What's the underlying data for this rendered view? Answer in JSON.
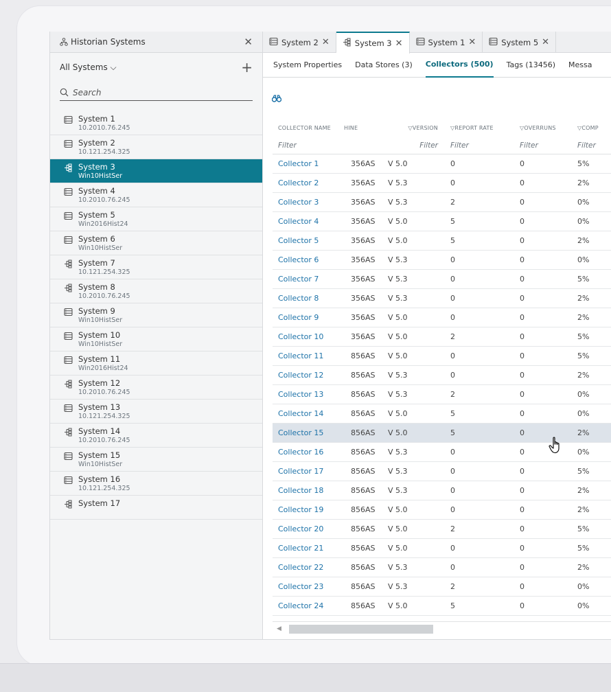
{
  "sidebar": {
    "title": "Historian Systems",
    "filter_label": "All Systems",
    "search_placeholder": "Search",
    "systems": [
      {
        "name": "System 1",
        "sub": "10.2010.76.245",
        "icon": "database-icon"
      },
      {
        "name": "System 2",
        "sub": "10.121.254.325",
        "icon": "database-icon"
      },
      {
        "name": "System 3",
        "sub": "Win10HistSer",
        "icon": "cluster-icon",
        "selected": true
      },
      {
        "name": "System 4",
        "sub": "10.2010.76.245",
        "icon": "database-icon"
      },
      {
        "name": "System 5",
        "sub": "Win2016Hist24",
        "icon": "database-icon"
      },
      {
        "name": "System 6",
        "sub": "Win10HistSer",
        "icon": "database-icon"
      },
      {
        "name": "System 7",
        "sub": "10.121.254.325",
        "icon": "cluster-icon"
      },
      {
        "name": "System 8",
        "sub": "10.2010.76.245",
        "icon": "cluster-icon"
      },
      {
        "name": "System 9",
        "sub": "Win10HistSer",
        "icon": "database-icon"
      },
      {
        "name": "System 10",
        "sub": "Win10HistSer",
        "icon": "database-icon"
      },
      {
        "name": "System 11",
        "sub": "Win2016Hist24",
        "icon": "database-icon"
      },
      {
        "name": "System 12",
        "sub": "10.2010.76.245",
        "icon": "cluster-icon"
      },
      {
        "name": "System 13",
        "sub": "10.121.254.325",
        "icon": "database-icon"
      },
      {
        "name": "System 14",
        "sub": "10.2010.76.245",
        "icon": "cluster-icon"
      },
      {
        "name": "System 15",
        "sub": "Win10HistSer",
        "icon": "database-icon"
      },
      {
        "name": "System 16",
        "sub": "10.121.254.325",
        "icon": "database-icon"
      },
      {
        "name": "System 17",
        "sub": "",
        "icon": "cluster-icon"
      }
    ]
  },
  "tabs": [
    {
      "label": "System 2",
      "icon": "database-icon"
    },
    {
      "label": "System 3",
      "icon": "cluster-icon",
      "active": true
    },
    {
      "label": "System 1",
      "icon": "database-icon"
    },
    {
      "label": "System 5",
      "icon": "database-icon"
    }
  ],
  "subtabs": [
    {
      "label": "System Properties"
    },
    {
      "label": "Data Stores (3)"
    },
    {
      "label": "Collectors (500)",
      "active": true
    },
    {
      "label": "Tags (13456)"
    },
    {
      "label": "Messa"
    }
  ],
  "grid": {
    "headers": [
      "COLLECTOR NAME",
      "HINE",
      "VERSION",
      "REPORT RATE",
      "OVERRUNS",
      "COMP"
    ],
    "filter_placeholder": "Filter",
    "rows": [
      {
        "name": "Collector 1",
        "machine": "356AS",
        "version": "V 5.0",
        "rate": "0",
        "overruns": "0",
        "comp": "5%"
      },
      {
        "name": "Collector 2",
        "machine": "356AS",
        "version": "V 5.3",
        "rate": "0",
        "overruns": "0",
        "comp": "2%"
      },
      {
        "name": "Collector 3",
        "machine": "356AS",
        "version": "V 5.3",
        "rate": "2",
        "overruns": "0",
        "comp": "0%"
      },
      {
        "name": "Collector 4",
        "machine": "356AS",
        "version": "V 5.0",
        "rate": "5",
        "overruns": "0",
        "comp": "0%"
      },
      {
        "name": "Collector 5",
        "machine": "356AS",
        "version": "V 5.0",
        "rate": "5",
        "overruns": "0",
        "comp": "2%"
      },
      {
        "name": "Collector 6",
        "machine": "356AS",
        "version": "V 5.3",
        "rate": "0",
        "overruns": "0",
        "comp": "0%"
      },
      {
        "name": "Collector 7",
        "machine": "356AS",
        "version": "V 5.3",
        "rate": "0",
        "overruns": "0",
        "comp": "5%"
      },
      {
        "name": "Collector 8",
        "machine": "356AS",
        "version": "V 5.3",
        "rate": "0",
        "overruns": "0",
        "comp": "2%"
      },
      {
        "name": "Collector 9",
        "machine": "356AS",
        "version": "V 5.0",
        "rate": "0",
        "overruns": "0",
        "comp": "2%"
      },
      {
        "name": "Collector 10",
        "machine": "356AS",
        "version": "V 5.0",
        "rate": "2",
        "overruns": "0",
        "comp": "5%"
      },
      {
        "name": "Collector 11",
        "machine": "856AS",
        "version": "V 5.0",
        "rate": "0",
        "overruns": "0",
        "comp": "5%"
      },
      {
        "name": "Collector 12",
        "machine": "856AS",
        "version": "V 5.3",
        "rate": "0",
        "overruns": "0",
        "comp": "2%"
      },
      {
        "name": "Collector 13",
        "machine": "856AS",
        "version": "V 5.3",
        "rate": "2",
        "overruns": "0",
        "comp": "0%"
      },
      {
        "name": "Collector 14",
        "machine": "856AS",
        "version": "V 5.0",
        "rate": "5",
        "overruns": "0",
        "comp": "0%"
      },
      {
        "name": "Collector 15",
        "machine": "856AS",
        "version": "V 5.0",
        "rate": "5",
        "overruns": "0",
        "comp": "2%",
        "highlight": true
      },
      {
        "name": "Collector 16",
        "machine": "856AS",
        "version": "V 5.3",
        "rate": "0",
        "overruns": "0",
        "comp": "0%"
      },
      {
        "name": "Collector 17",
        "machine": "856AS",
        "version": "V 5.3",
        "rate": "0",
        "overruns": "0",
        "comp": "5%"
      },
      {
        "name": "Collector 18",
        "machine": "856AS",
        "version": "V 5.3",
        "rate": "0",
        "overruns": "0",
        "comp": "2%"
      },
      {
        "name": "Collector 19",
        "machine": "856AS",
        "version": "V 5.0",
        "rate": "0",
        "overruns": "0",
        "comp": "2%"
      },
      {
        "name": "Collector 20",
        "machine": "856AS",
        "version": "V 5.0",
        "rate": "2",
        "overruns": "0",
        "comp": "5%"
      },
      {
        "name": "Collector 21",
        "machine": "856AS",
        "version": "V 5.0",
        "rate": "0",
        "overruns": "0",
        "comp": "5%"
      },
      {
        "name": "Collector 22",
        "machine": "856AS",
        "version": "V 5.3",
        "rate": "0",
        "overruns": "0",
        "comp": "2%"
      },
      {
        "name": "Collector 23",
        "machine": "856AS",
        "version": "V 5.3",
        "rate": "2",
        "overruns": "0",
        "comp": "0%"
      },
      {
        "name": "Collector 24",
        "machine": "856AS",
        "version": "V 5.0",
        "rate": "5",
        "overruns": "0",
        "comp": "0%"
      }
    ]
  },
  "colors": {
    "accent": "#0d7a8f",
    "link": "#1d72a8",
    "row_highlight": "#dde3ea"
  }
}
